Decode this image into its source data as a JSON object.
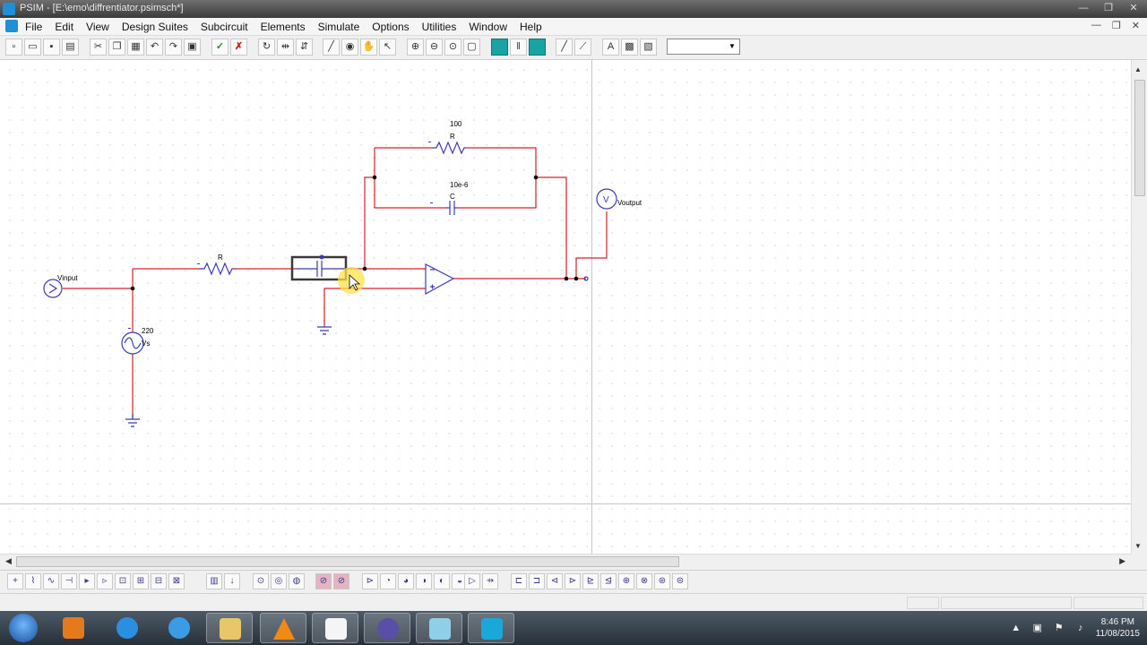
{
  "window": {
    "title": "PSIM - [E:\\emo\\diffrentiator.psimsch*]",
    "controls": [
      "—",
      "❐",
      "✕"
    ]
  },
  "menu": {
    "items": [
      "File",
      "Edit",
      "View",
      "Design Suites",
      "Subcircuit",
      "Elements",
      "Simulate",
      "Options",
      "Utilities",
      "Window",
      "Help"
    ],
    "controls": [
      "—",
      "❐",
      "✕"
    ]
  },
  "toolbar": {
    "zoom_value": ""
  },
  "schematic": {
    "labels": {
      "vinput": "Vinput",
      "vs_value": "220",
      "vs_name": "Vs",
      "r_in": "R",
      "r_fb_value": "100",
      "r_fb": "R",
      "c_fb_value": "10e-6",
      "c_fb": "C",
      "voutput": "Voutput",
      "voltmeter_glyph": "V"
    },
    "colors": {
      "wire": "#d8222a",
      "component": "#3b3bb8",
      "node": "#000000",
      "selection": "#3a3a3a",
      "cursor_glow": "#ffe24a"
    }
  },
  "taskbar": {
    "time": "8:46 PM",
    "date": "11/08/2015"
  }
}
